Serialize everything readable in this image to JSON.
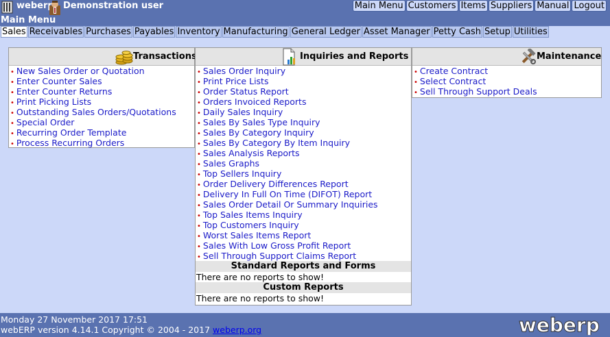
{
  "header": {
    "app_name": "weberp",
    "user_name": "Demonstration user",
    "main_menu_label": "Main Menu",
    "top_links": [
      "Main Menu",
      "Customers",
      "Items",
      "Suppliers",
      "Manual",
      "Logout"
    ]
  },
  "modules": {
    "active": "Sales",
    "tabs": [
      "Sales",
      "Receivables",
      "Purchases",
      "Payables",
      "Inventory",
      "Manufacturing",
      "General Ledger",
      "Asset Manager",
      "Petty Cash",
      "Setup",
      "Utilities"
    ]
  },
  "transactions": {
    "title": "Transactions",
    "icon": "coins-icon",
    "items": [
      "New Sales Order or Quotation",
      "Enter Counter Sales",
      "Enter Counter Returns",
      "Print Picking Lists",
      "Outstanding Sales Orders/Quotations",
      "Special Order",
      "Recurring Order Template",
      "Process Recurring Orders"
    ]
  },
  "inquiries": {
    "title": "Inquiries and Reports",
    "icon": "report-chart-icon",
    "items": [
      "Sales Order Inquiry",
      "Print Price Lists",
      "Order Status Report",
      "Orders Invoiced Reports",
      "Daily Sales Inquiry",
      "Sales By Sales Type Inquiry",
      "Sales By Category Inquiry",
      "Sales By Category By Item Inquiry",
      "Sales Analysis Reports",
      "Sales Graphs",
      "Top Sellers Inquiry",
      "Order Delivery Differences Report",
      "Delivery In Full On Time (DIFOT) Report",
      "Sales Order Detail Or Summary Inquiries",
      "Top Sales Items Inquiry",
      "Top Customers Inquiry",
      "Worst Sales Items Report",
      "Sales With Low Gross Profit Report",
      "Sell Through Support Claims Report"
    ],
    "standard_reports_title": "Standard Reports and Forms",
    "standard_reports_note": "There are no reports to show!",
    "custom_reports_title": "Custom Reports",
    "custom_reports_note": "There are no reports to show!"
  },
  "maintenance": {
    "title": "Maintenance",
    "icon": "tools-icon",
    "items": [
      "Create Contract",
      "Select Contract",
      "Sell Through Support Deals"
    ]
  },
  "footer": {
    "datetime": "Monday 27 November 2017 17:51",
    "copyright": "webERP version 4.14.1 Copyright © 2004 - 2017",
    "site_link": "weberp.org",
    "logo_text": "weberp"
  },
  "colors": {
    "header_bg": "#5a72b0",
    "page_bg": "#ccd8f9",
    "link": "#1a1ac8",
    "bullet": "#cc0000"
  }
}
